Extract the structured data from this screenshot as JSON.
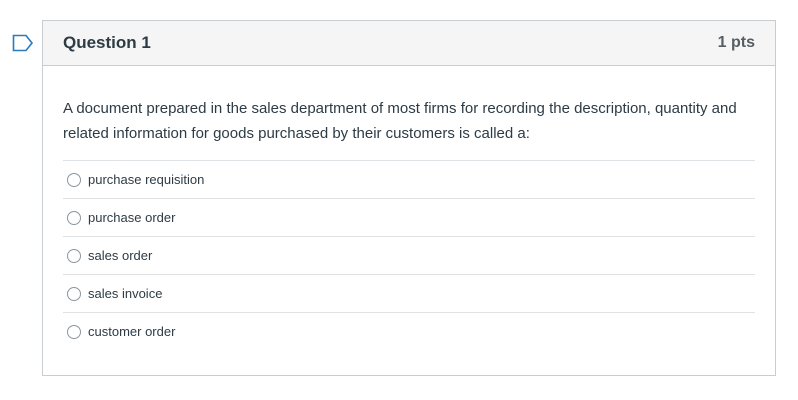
{
  "question": {
    "title": "Question 1",
    "points": "1 pts",
    "text": "A document prepared in the sales department of most firms for recording the description, quantity and related information for goods purchased by their customers is called a:",
    "answers": [
      {
        "label": "purchase requisition"
      },
      {
        "label": "purchase order"
      },
      {
        "label": "sales order"
      },
      {
        "label": "sales invoice"
      },
      {
        "label": "customer order"
      }
    ]
  },
  "colors": {
    "flag": "#2b7abc",
    "header_bg": "#f5f5f5",
    "border": "#c7cdd1",
    "text": "#2d3b45"
  },
  "icons": {
    "flag": "bookmark-flag-icon",
    "radio": "radio-button-icon"
  }
}
